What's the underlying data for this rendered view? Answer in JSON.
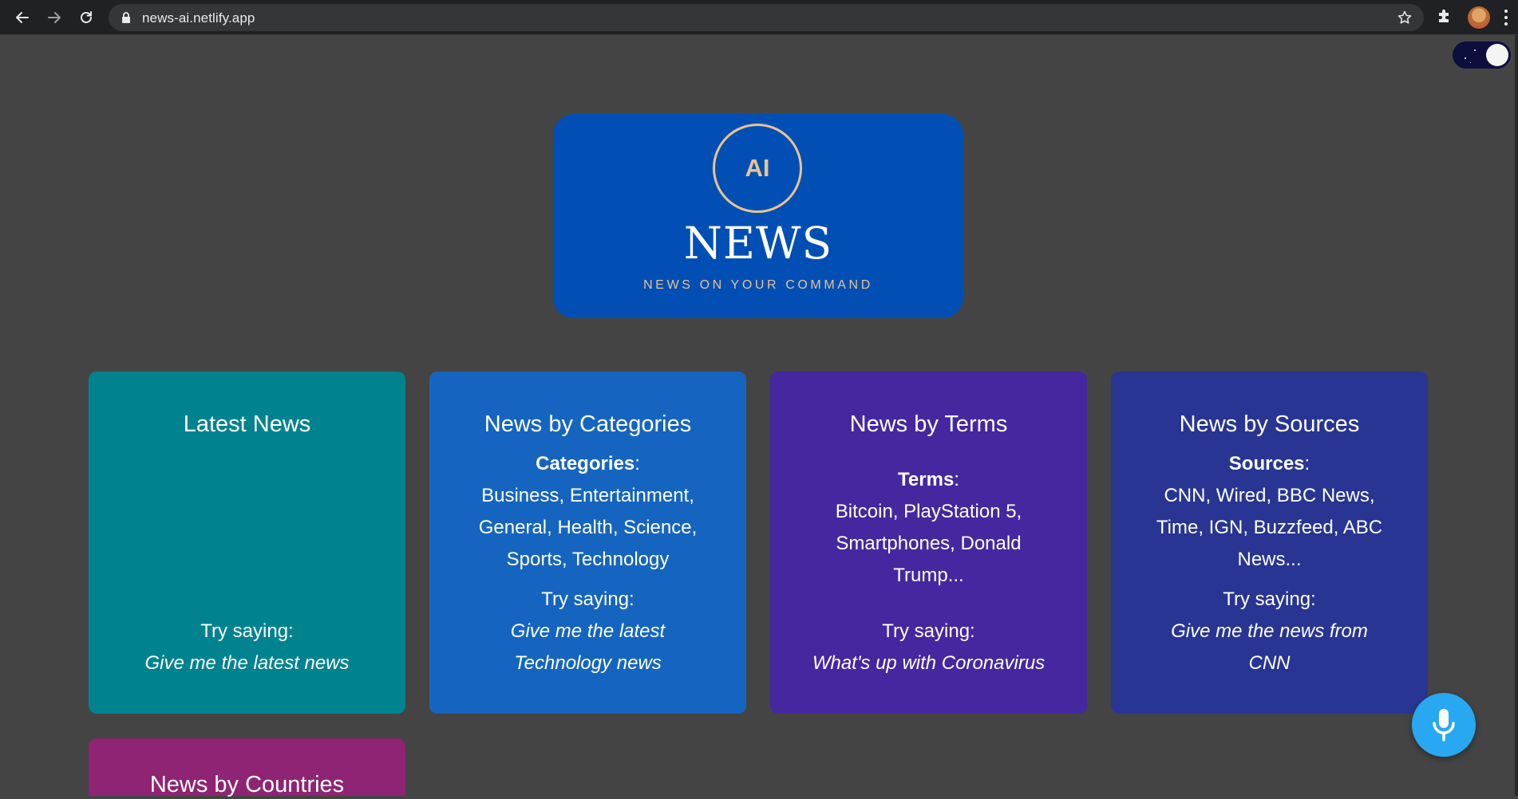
{
  "browser": {
    "url": "news-ai.netlify.app"
  },
  "logo": {
    "badge": "AI",
    "title": "NEWS",
    "tagline": "NEWS ON YOUR COMMAND"
  },
  "cards": [
    {
      "title": "Latest News",
      "try_label": "Try saying:",
      "try_phrase": "Give me the latest news",
      "color": "#00838f"
    },
    {
      "title": "News by Categories",
      "info_label": "Categories",
      "info_sep": ":",
      "info_text": "Business, Entertainment, General, Health, Science, Sports, Technology",
      "try_label": "Try saying:",
      "try_phrase": "Give me the latest Technology news",
      "color": "#1565c0"
    },
    {
      "title": "News by Terms",
      "info_label": "Terms",
      "info_sep": ":",
      "info_text": "Bitcoin, PlayStation 5, Smartphones, Donald Trump...",
      "try_label": "Try saying:",
      "try_phrase": "What's up with Coronavirus",
      "color": "#4527a0"
    },
    {
      "title": "News by Sources",
      "info_label": "Sources",
      "info_sep": ":",
      "info_text": "CNN, Wired, BBC News, Time, IGN, Buzzfeed, ABC News...",
      "try_label": "Try saying:",
      "try_phrase": "Give me the news from CNN",
      "color": "#283593"
    },
    {
      "title": "News by Countries",
      "color": "#8e2473"
    }
  ],
  "icons": {
    "back": "arrow-left-icon",
    "forward": "arrow-right-icon",
    "reload": "reload-icon",
    "lock": "lock-icon",
    "bookmark": "star-icon",
    "extensions": "puzzle-icon",
    "menu": "more-vert-icon",
    "mic": "microphone-icon"
  },
  "colors": {
    "page_bg": "#444444",
    "logo_bg": "#014fb5",
    "logo_gold": "#e9c38e",
    "mic_bg": "#28a8f0"
  }
}
